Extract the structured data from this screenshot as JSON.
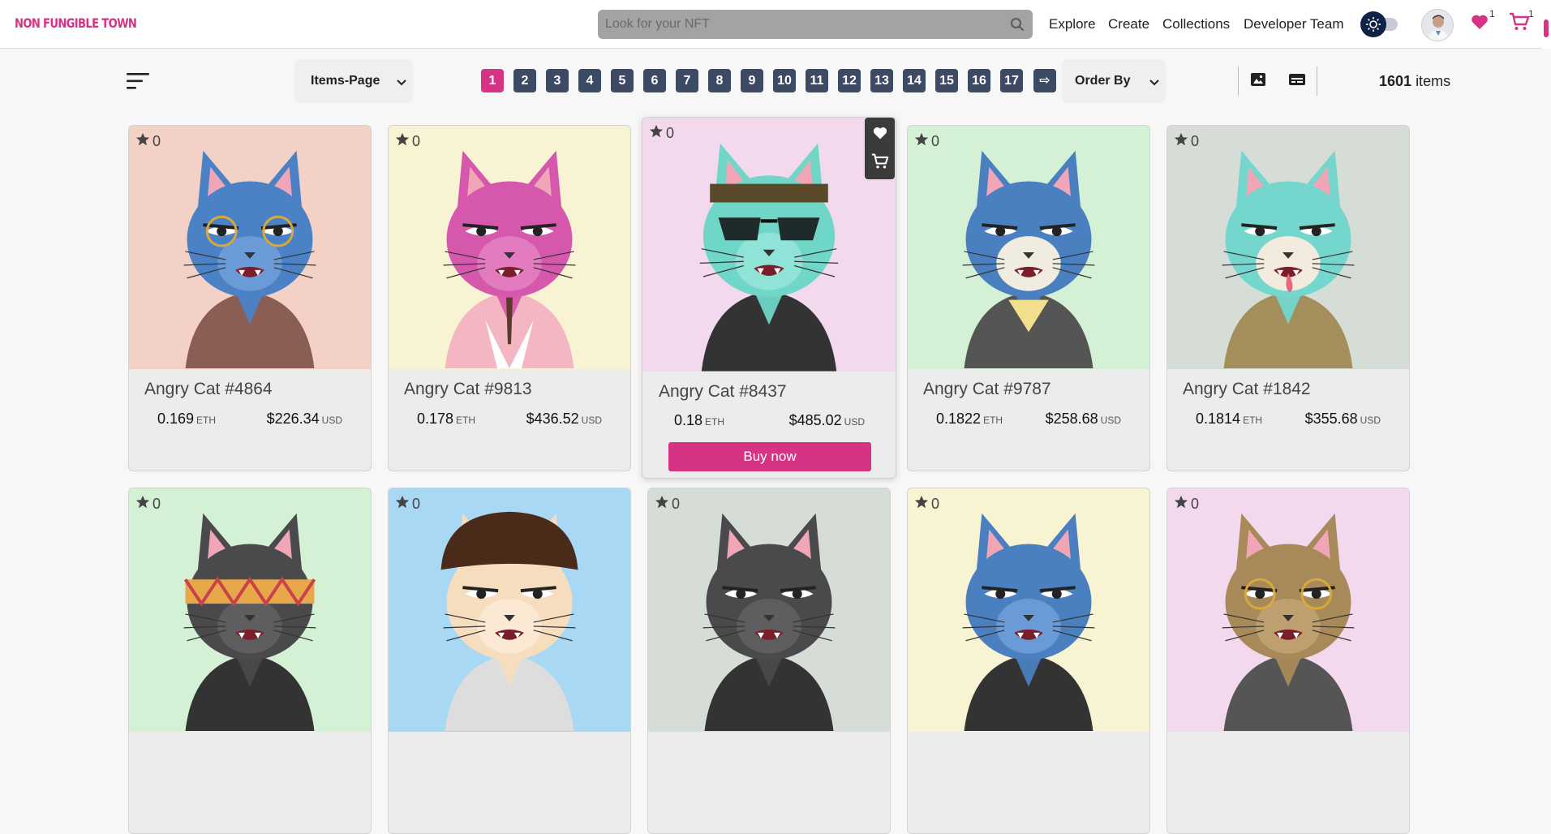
{
  "navbar": {
    "logo": "NON FUNGIBLE TOWN",
    "search_placeholder": "Look for your NFT",
    "links": [
      "Explore",
      "Create",
      "Collections",
      "Developer Team"
    ],
    "favorites_count": "1",
    "cart_count": "1"
  },
  "toolbar": {
    "items_per_page_label": "Items-Page",
    "order_by_label": "Order By",
    "pages": [
      "1",
      "2",
      "3",
      "4",
      "5",
      "6",
      "7",
      "8",
      "9",
      "10",
      "11",
      "12",
      "13",
      "14",
      "15",
      "16",
      "17"
    ],
    "current_page": "1",
    "next_symbol": "⇨",
    "items_total": "1601",
    "items_label": "items"
  },
  "colors": {
    "accent": "#d63384",
    "page_button": "#3d4a64",
    "navy": "#0d2244"
  },
  "cards": [
    {
      "title": "Angry Cat #4864",
      "favorites": "0",
      "eth": "0.169",
      "usd": "$226.34",
      "eth_unit": "ETH",
      "usd_unit": "USD"
    },
    {
      "title": "Angry Cat #9813",
      "favorites": "0",
      "eth": "0.178",
      "usd": "$436.52",
      "eth_unit": "ETH",
      "usd_unit": "USD"
    },
    {
      "title": "Angry Cat #8437",
      "favorites": "0",
      "eth": "0.18",
      "usd": "$485.02",
      "eth_unit": "ETH",
      "usd_unit": "USD",
      "buy_label": "Buy now"
    },
    {
      "title": "Angry Cat #9787",
      "favorites": "0",
      "eth": "0.1822",
      "usd": "$258.68",
      "eth_unit": "ETH",
      "usd_unit": "USD"
    },
    {
      "title": "Angry Cat #1842",
      "favorites": "0",
      "eth": "0.1814",
      "usd": "$355.68",
      "eth_unit": "ETH",
      "usd_unit": "USD"
    },
    {
      "favorites": "0"
    },
    {
      "favorites": "0"
    },
    {
      "favorites": "0"
    },
    {
      "favorites": "0"
    },
    {
      "favorites": "0"
    }
  ]
}
